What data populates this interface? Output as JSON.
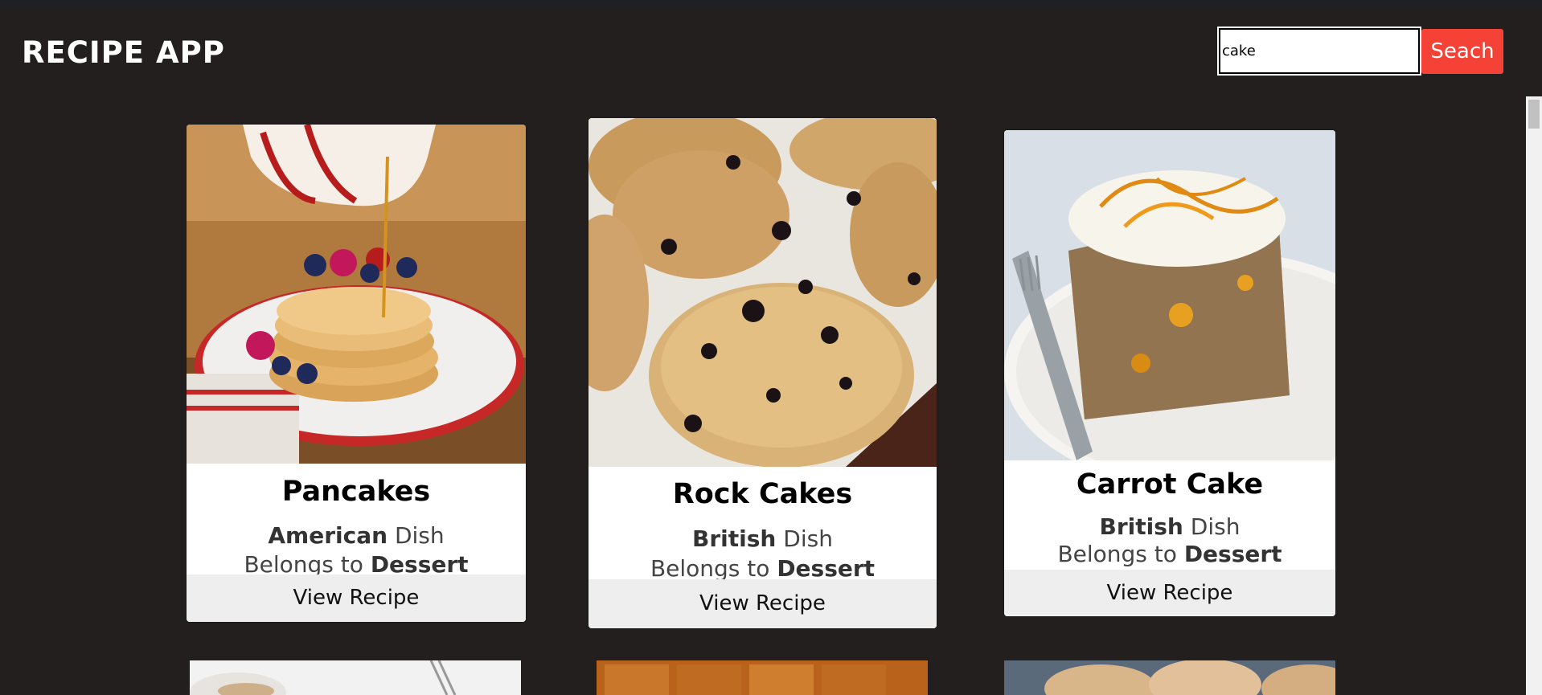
{
  "header": {
    "title": "RECIPE APP",
    "search_value": "cake",
    "search_button_label": "Seach"
  },
  "recipes": [
    {
      "name": "Pancakes",
      "area": "American",
      "area_suffix": "Dish",
      "belongs_prefix": "Belongs to",
      "category": "Dessert",
      "button_label": "View Recipe"
    },
    {
      "name": "Rock Cakes",
      "area": "British",
      "area_suffix": "Dish",
      "belongs_prefix": "Belongs to",
      "category": "Dessert",
      "button_label": "View Recipe"
    },
    {
      "name": "Carrot Cake",
      "area": "British",
      "area_suffix": "Dish",
      "belongs_prefix": "Belongs to",
      "category": "Dessert",
      "button_label": "View Recipe"
    }
  ],
  "colors": {
    "background": "#231f1e",
    "search_button": "#f44336",
    "card": "#ffffff",
    "view_button": "#eeeeee"
  }
}
